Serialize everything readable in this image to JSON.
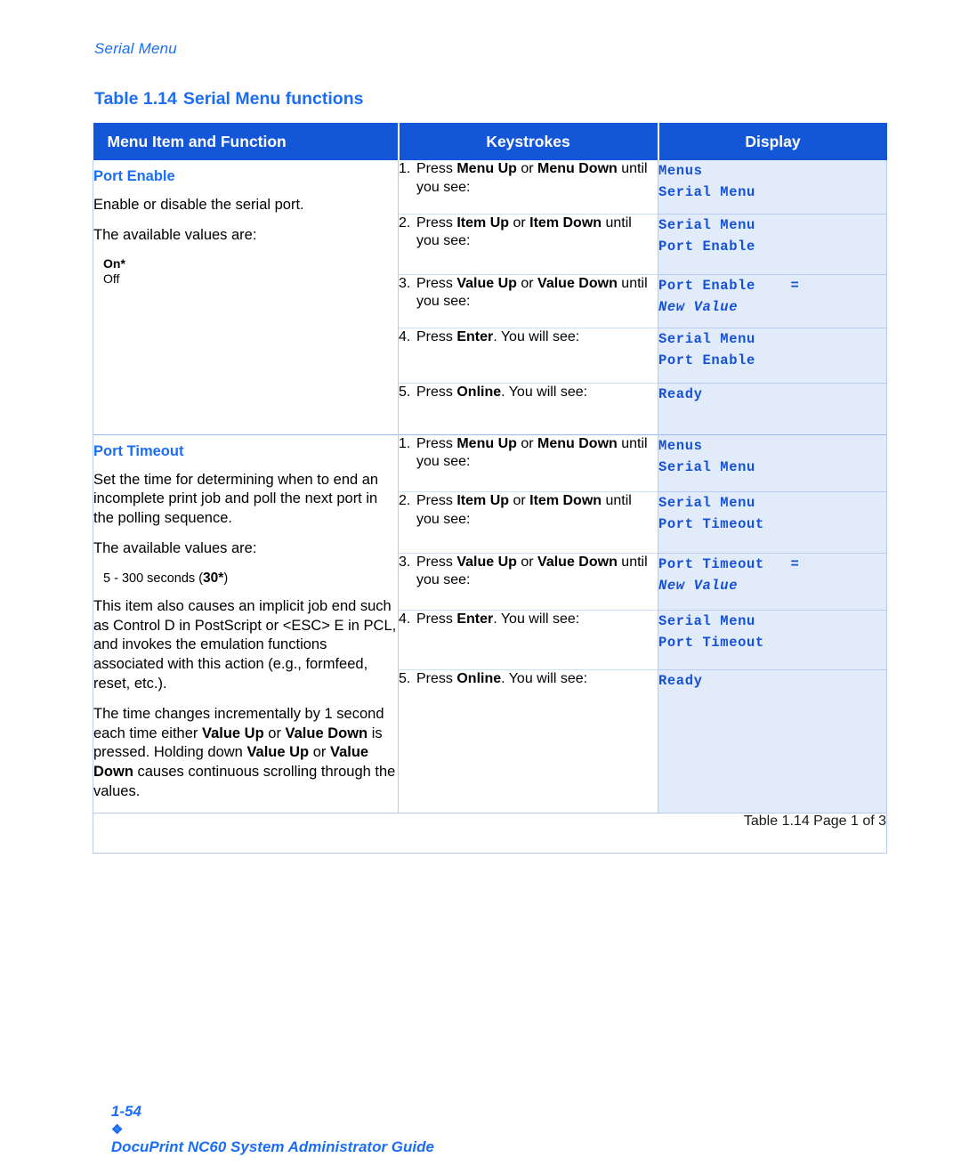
{
  "running_head": "Serial Menu",
  "table_caption": {
    "number": "Table 1.14",
    "title": "Serial Menu functions"
  },
  "table_headers": {
    "function": "Menu Item and Function",
    "keystrokes": "Keystrokes",
    "display": "Display"
  },
  "sections": [
    {
      "function": {
        "title": "Port Enable",
        "description": "Enable or disable the serial port.",
        "values_intro": "The available values are:",
        "values": [
          "On*",
          "Off"
        ]
      },
      "steps": [
        {
          "num": "1.",
          "keystroke_parts": [
            "Press ",
            "Menu Up",
            " or ",
            "Menu Down",
            " until you see:"
          ],
          "display_line1": "Menus",
          "display_line2": "Serial Menu",
          "display_line2_italic": false
        },
        {
          "num": "2.",
          "keystroke_parts": [
            "Press ",
            "Item Up",
            " or ",
            "Item Down",
            " until you see:"
          ],
          "display_line1": "Serial Menu",
          "display_line2": "Port Enable",
          "display_line2_italic": false
        },
        {
          "num": "3.",
          "keystroke_parts": [
            "Press ",
            "Value Up",
            " or ",
            "Value Down",
            " until you see:"
          ],
          "display_line1": "Port Enable    =",
          "display_line2": "New Value",
          "display_line2_italic": true
        },
        {
          "num": "4.",
          "keystroke_parts": [
            "Press ",
            "Enter",
            ". You will see:",
            "",
            ""
          ],
          "display_line1": "Serial Menu",
          "display_line2": "Port Enable",
          "display_line2_italic": false
        },
        {
          "num": "5.",
          "keystroke_parts": [
            "Press ",
            "Online",
            ". You will see:",
            "",
            ""
          ],
          "display_line1": "Ready",
          "display_line2": "",
          "display_line2_italic": false
        }
      ]
    },
    {
      "function": {
        "title": "Port Timeout",
        "description": "Set the time for determining when to end an incomplete print job and poll the next port in the polling sequence.",
        "values_intro": "The available values are:",
        "range_prefix": "5 - 300 seconds (",
        "range_default": "30*",
        "range_suffix": ")",
        "note1": "This item also causes an implicit job end such as Control D in PostScript or <ESC> E in PCL, and invokes the emulation functions associated with this action (e.g., formfeed, reset, etc.).",
        "note2_parts": [
          "The time changes incrementally by 1 second each time either ",
          "Value Up",
          " or ",
          "Value Down",
          " is pressed. Holding down ",
          "Value Up",
          " or ",
          "Value Down",
          " causes continuous scrolling through the values."
        ]
      },
      "steps": [
        {
          "num": "1.",
          "keystroke_parts": [
            "Press ",
            "Menu Up",
            " or ",
            "Menu Down",
            " until you see:"
          ],
          "display_line1": "Menus",
          "display_line2": "Serial Menu",
          "display_line2_italic": false
        },
        {
          "num": "2.",
          "keystroke_parts": [
            "Press ",
            "Item Up",
            " or ",
            "Item Down",
            " until you see:"
          ],
          "display_line1": "Serial Menu",
          "display_line2": "Port Timeout",
          "display_line2_italic": false
        },
        {
          "num": "3.",
          "keystroke_parts": [
            "Press ",
            "Value Up",
            " or ",
            "Value Down",
            " until you see:"
          ],
          "display_line1": "Port Timeout   =",
          "display_line2": "New Value",
          "display_line2_italic": true
        },
        {
          "num": "4.",
          "keystroke_parts": [
            "Press ",
            "Enter",
            ". You will see:",
            "",
            ""
          ],
          "display_line1": "Serial Menu",
          "display_line2": "Port Timeout",
          "display_line2_italic": false
        },
        {
          "num": "5.",
          "keystroke_parts": [
            "Press ",
            "Online",
            ". You will see:",
            "",
            ""
          ],
          "display_line1": "Ready",
          "display_line2": "",
          "display_line2_italic": false
        }
      ]
    }
  ],
  "table_footer_note": "Table 1.14  Page 1 of 3",
  "page_footer": {
    "page_number": "1-54",
    "diamond": "❖",
    "document_title": "DocuPrint NC60 System Administrator Guide"
  },
  "colors": {
    "header_blue": "#1357d8",
    "accent_blue": "#1b6ef3",
    "display_bg": "#e2ebfa",
    "display_text": "#1551d6",
    "border": "#b6ccf3"
  }
}
